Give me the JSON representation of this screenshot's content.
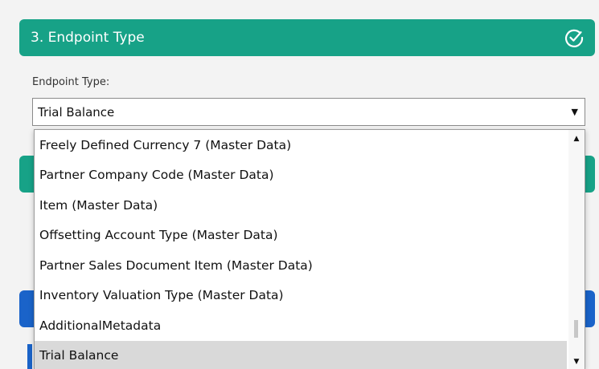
{
  "section": {
    "title": "3. Endpoint Type",
    "check_icon": "check-circle-icon"
  },
  "field": {
    "label": "Endpoint Type:",
    "value": "Trial Balance"
  },
  "dropdown": {
    "options": [
      "Freely Defined Currency 7 (Master Data)",
      "Partner Company Code (Master Data)",
      "Item (Master Data)",
      "Offsetting Account Type (Master Data)",
      "Partner Sales Document Item (Master Data)",
      "Inventory Valuation Type (Master Data)",
      "AdditionalMetadata",
      "Trial Balance"
    ],
    "selected_index": 7
  },
  "colors": {
    "teal": "#17a287",
    "blue": "#1a63c9",
    "selected_bg": "#d9d9d9"
  }
}
